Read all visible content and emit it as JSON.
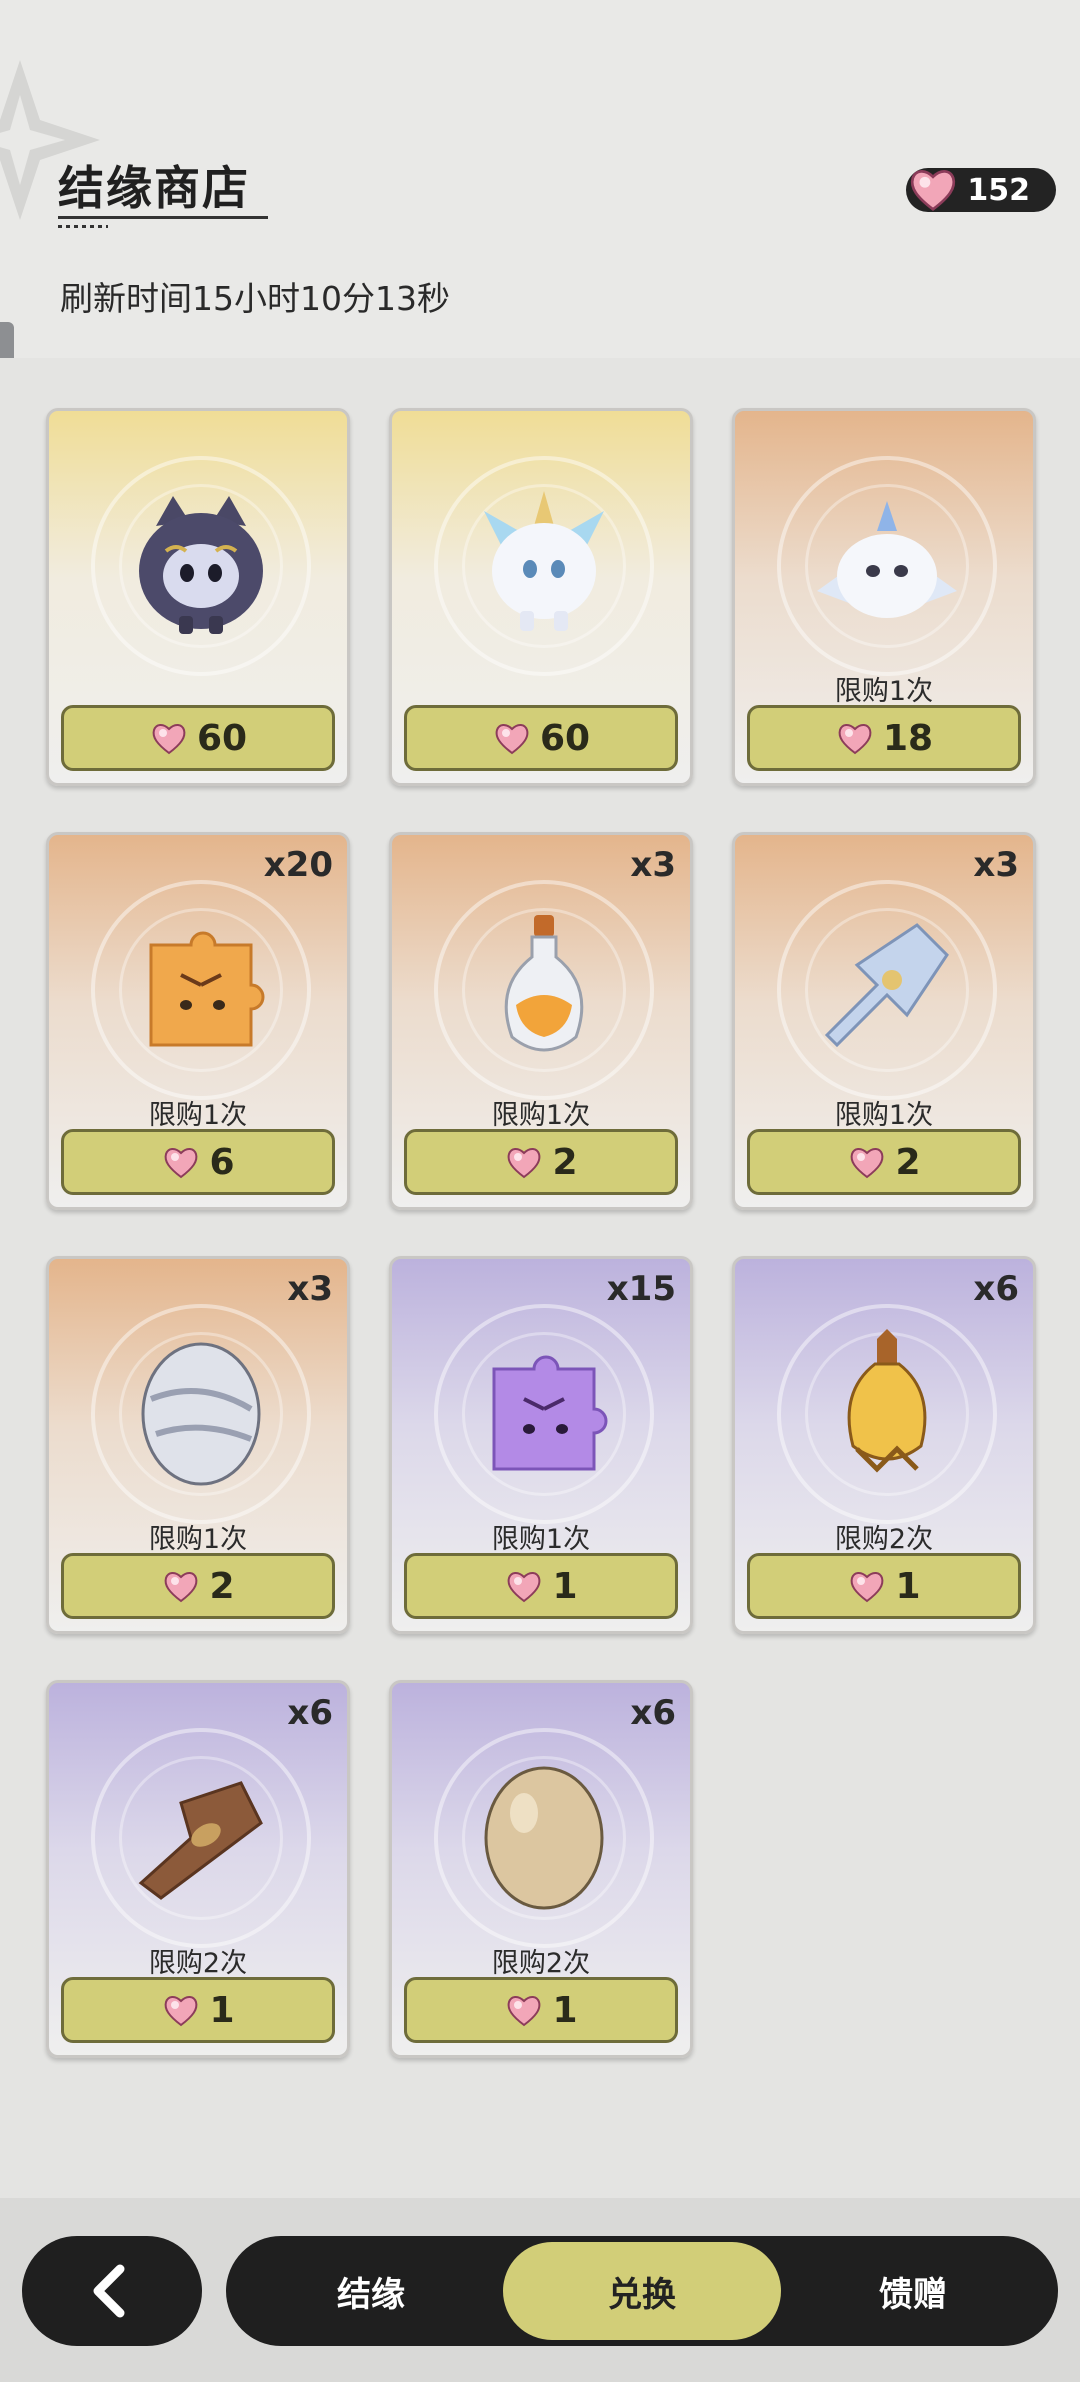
{
  "header": {
    "title": "结缘商店",
    "currency_amount": "152",
    "refresh_text": "刷新时间15小时10分13秒"
  },
  "items": [
    {
      "qty": "",
      "limit": "",
      "price": "60",
      "art": "black-cat-pet-icon",
      "bg": "gold"
    },
    {
      "qty": "",
      "limit": "",
      "price": "60",
      "art": "white-fox-pet-icon",
      "bg": "gold"
    },
    {
      "qty": "",
      "limit": "限购1次",
      "price": "18",
      "art": "white-cloud-pet-icon",
      "bg": "orange"
    },
    {
      "qty": "x20",
      "limit": "限购1次",
      "price": "6",
      "art": "orange-cat-puzzle-icon",
      "bg": "orange"
    },
    {
      "qty": "x3",
      "limit": "限购1次",
      "price": "2",
      "art": "orange-potion-bottle-icon",
      "bg": "orange"
    },
    {
      "qty": "x3",
      "limit": "限购1次",
      "price": "2",
      "art": "blue-ribbon-icon",
      "bg": "orange"
    },
    {
      "qty": "x3",
      "limit": "限购1次",
      "price": "2",
      "art": "silver-egg-icon",
      "bg": "orange"
    },
    {
      "qty": "x15",
      "limit": "限购1次",
      "price": "1",
      "art": "purple-cat-puzzle-icon",
      "bg": "purple"
    },
    {
      "qty": "x6",
      "limit": "限购2次",
      "price": "1",
      "art": "amber-potion-icon",
      "bg": "purple"
    },
    {
      "qty": "x6",
      "limit": "限购2次",
      "price": "1",
      "art": "brown-bundle-icon",
      "bg": "purple"
    },
    {
      "qty": "x6",
      "limit": "限购2次",
      "price": "1",
      "art": "plain-egg-icon",
      "bg": "purple"
    }
  ],
  "bottom_nav": {
    "tabs": [
      "结缘",
      "兑换",
      "馈赠"
    ],
    "active_tab": "兑换"
  },
  "colors": {
    "price_button": "#d2ce78",
    "nav_dark": "#1f1f1f",
    "gem_pink": "#f2a6b8"
  }
}
